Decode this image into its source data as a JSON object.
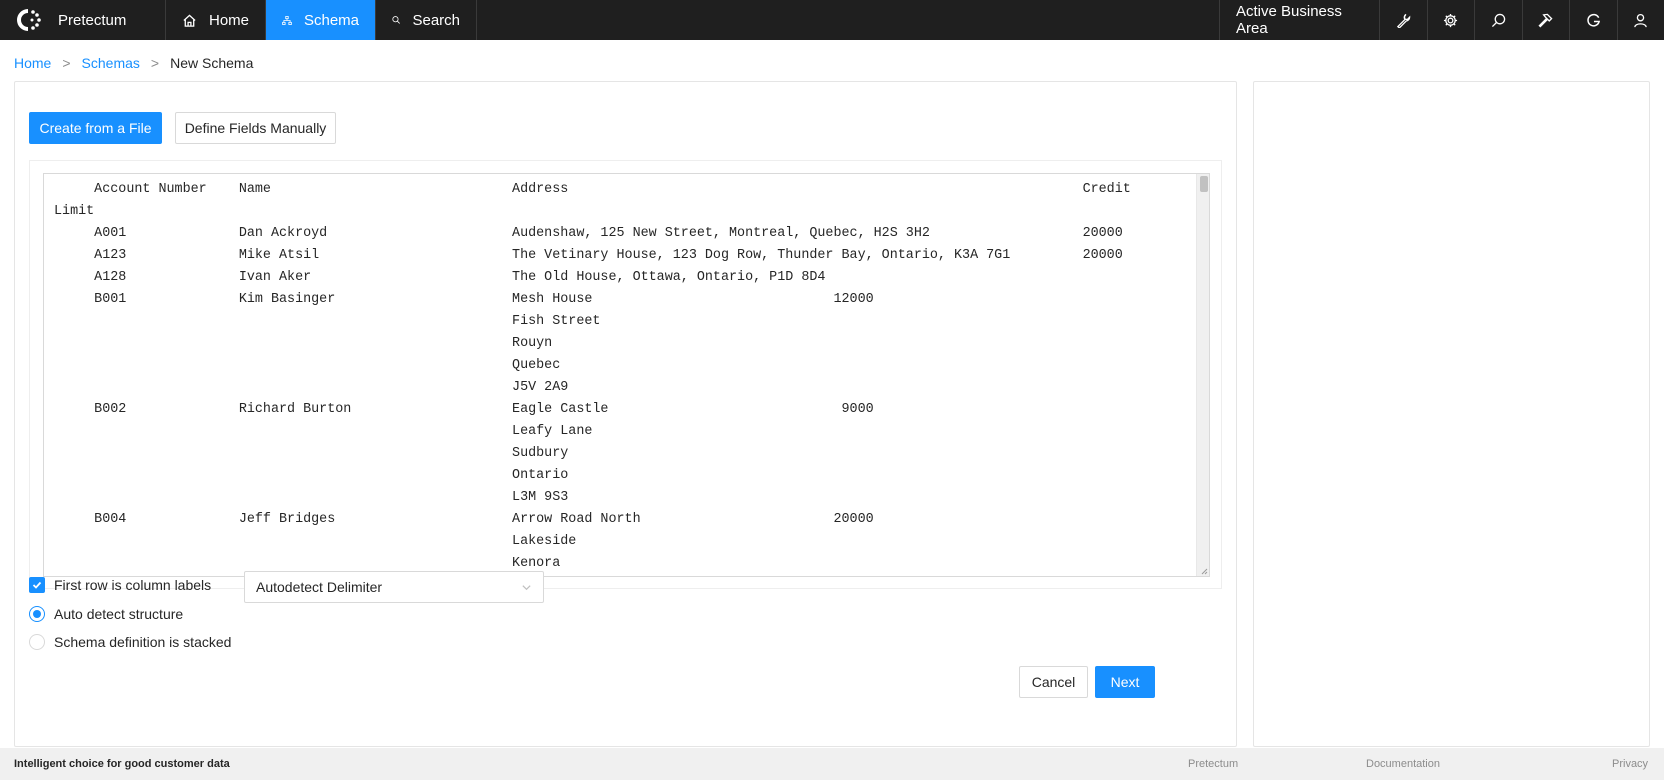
{
  "app": {
    "name": "Pretectum"
  },
  "nav": {
    "home": "Home",
    "schema": "Schema",
    "search": "Search",
    "active_area": "Active Business Area"
  },
  "breadcrumb": {
    "home": "Home",
    "schemas": "Schemas",
    "current": "New Schema",
    "separator": ">"
  },
  "tabs": {
    "create_from_file": "Create from a File",
    "define_manually": "Define Fields Manually"
  },
  "preview_text": "     Account Number    Name                              Address                                                                Credit\nLimit\n     A001              Dan Ackroyd                       Audenshaw, 125 New Street, Montreal, Quebec, H2S 3H2                   20000\n     A123              Mike Atsil                        The Vetinary House, 123 Dog Row, Thunder Bay, Ontario, K3A 7G1         20000\n     A128              Ivan Aker                         The Old House, Ottawa, Ontario, P1D 8D4\n     B001              Kim Basinger                      Mesh House                              12000\n                                                         Fish Street\n                                                         Rouyn\n                                                         Quebec\n                                                         J5V 2A9\n     B002              Richard Burton                    Eagle Castle                             9000\n                                                         Leafy Lane\n                                                         Sudbury\n                                                         Ontario\n                                                         L3M 9S3\n     B004              Jeff Bridges                      Arrow Road North                        20000\n                                                         Lakeside\n                                                         Kenora",
  "options": {
    "first_row_labels": "First row is column labels",
    "auto_detect": "Auto detect structure",
    "stacked": "Schema definition is stacked"
  },
  "delimiter": {
    "selected": "Autodetect Delimiter"
  },
  "actions": {
    "cancel": "Cancel",
    "next": "Next"
  },
  "footer": {
    "tagline": "Intelligent choice for good customer data",
    "links": [
      "Pretectum",
      "Documentation",
      "Privacy"
    ]
  },
  "colors": {
    "accent": "#1890ff",
    "nav_bg": "#1f1f1f",
    "footer_bg": "#f0f0f0"
  }
}
